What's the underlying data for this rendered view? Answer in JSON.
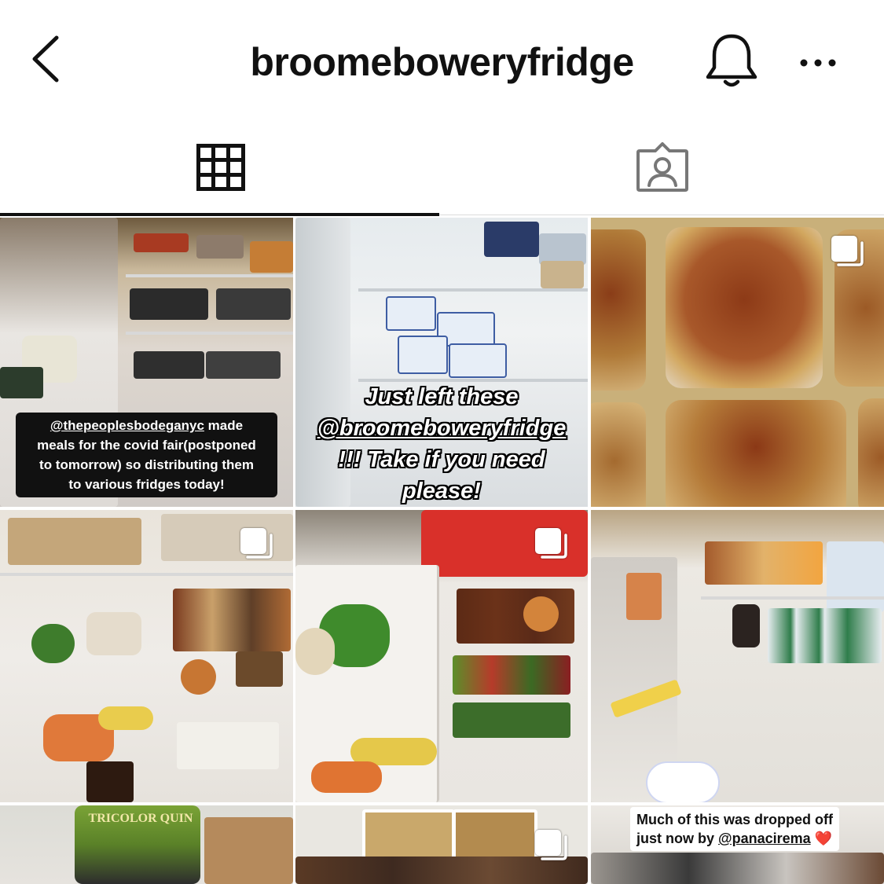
{
  "header": {
    "title": "broomeboweryfridge",
    "back_icon": "chevron-left-icon",
    "notification_icon": "bell-icon",
    "more_icon": "more-horizontal-icon"
  },
  "tabs": [
    {
      "name": "posts-grid",
      "icon": "grid-icon",
      "active": true
    },
    {
      "name": "tagged",
      "icon": "tagged-person-icon",
      "active": false
    }
  ],
  "posts": [
    {
      "caption_lines": [
        {
          "parts": [
            {
              "text": "@thepeoplesbodeganyc",
              "underline": true
            },
            {
              "text": " made",
              "underline": false
            }
          ]
        },
        {
          "parts": [
            {
              "text": "meals for the covid fair(postponed",
              "underline": false
            }
          ]
        },
        {
          "parts": [
            {
              "text": "to tomorrow) so distributing them",
              "underline": false
            }
          ]
        },
        {
          "parts": [
            {
              "text": "to various fridges today!",
              "underline": false
            }
          ]
        }
      ],
      "multi": false
    },
    {
      "caption_lines": [
        {
          "parts": [
            {
              "text": "Just left these",
              "underline": false
            }
          ]
        },
        {
          "parts": [
            {
              "text": "@broomeboweryfridge",
              "underline": true
            }
          ]
        },
        {
          "parts": [
            {
              "text": "!!! Take if you need",
              "underline": false
            }
          ]
        },
        {
          "parts": [
            {
              "text": "please!",
              "underline": false
            }
          ]
        }
      ],
      "multi": false
    },
    {
      "caption_lines": [],
      "multi": true
    },
    {
      "caption_lines": [],
      "multi": true
    },
    {
      "caption_lines": [],
      "multi": true
    },
    {
      "caption_lines": [],
      "multi": false
    },
    {
      "caption_lines": [],
      "multi": false,
      "package_label": "TRICOLOR QUIN"
    },
    {
      "caption_lines": [],
      "multi": true
    },
    {
      "caption_lines": [
        {
          "parts": [
            {
              "text": "Much of this was dropped off",
              "underline": false
            }
          ]
        },
        {
          "parts": [
            {
              "text": "just now by ",
              "underline": false
            },
            {
              "text": "@panacirema",
              "underline": true
            },
            {
              "text": " ❤️",
              "underline": false
            }
          ]
        }
      ],
      "multi": false
    }
  ],
  "colors": {
    "text": "#111111",
    "divider": "#dbdbdb",
    "heart": "#e02424",
    "fridge_red": "#d9302a"
  }
}
